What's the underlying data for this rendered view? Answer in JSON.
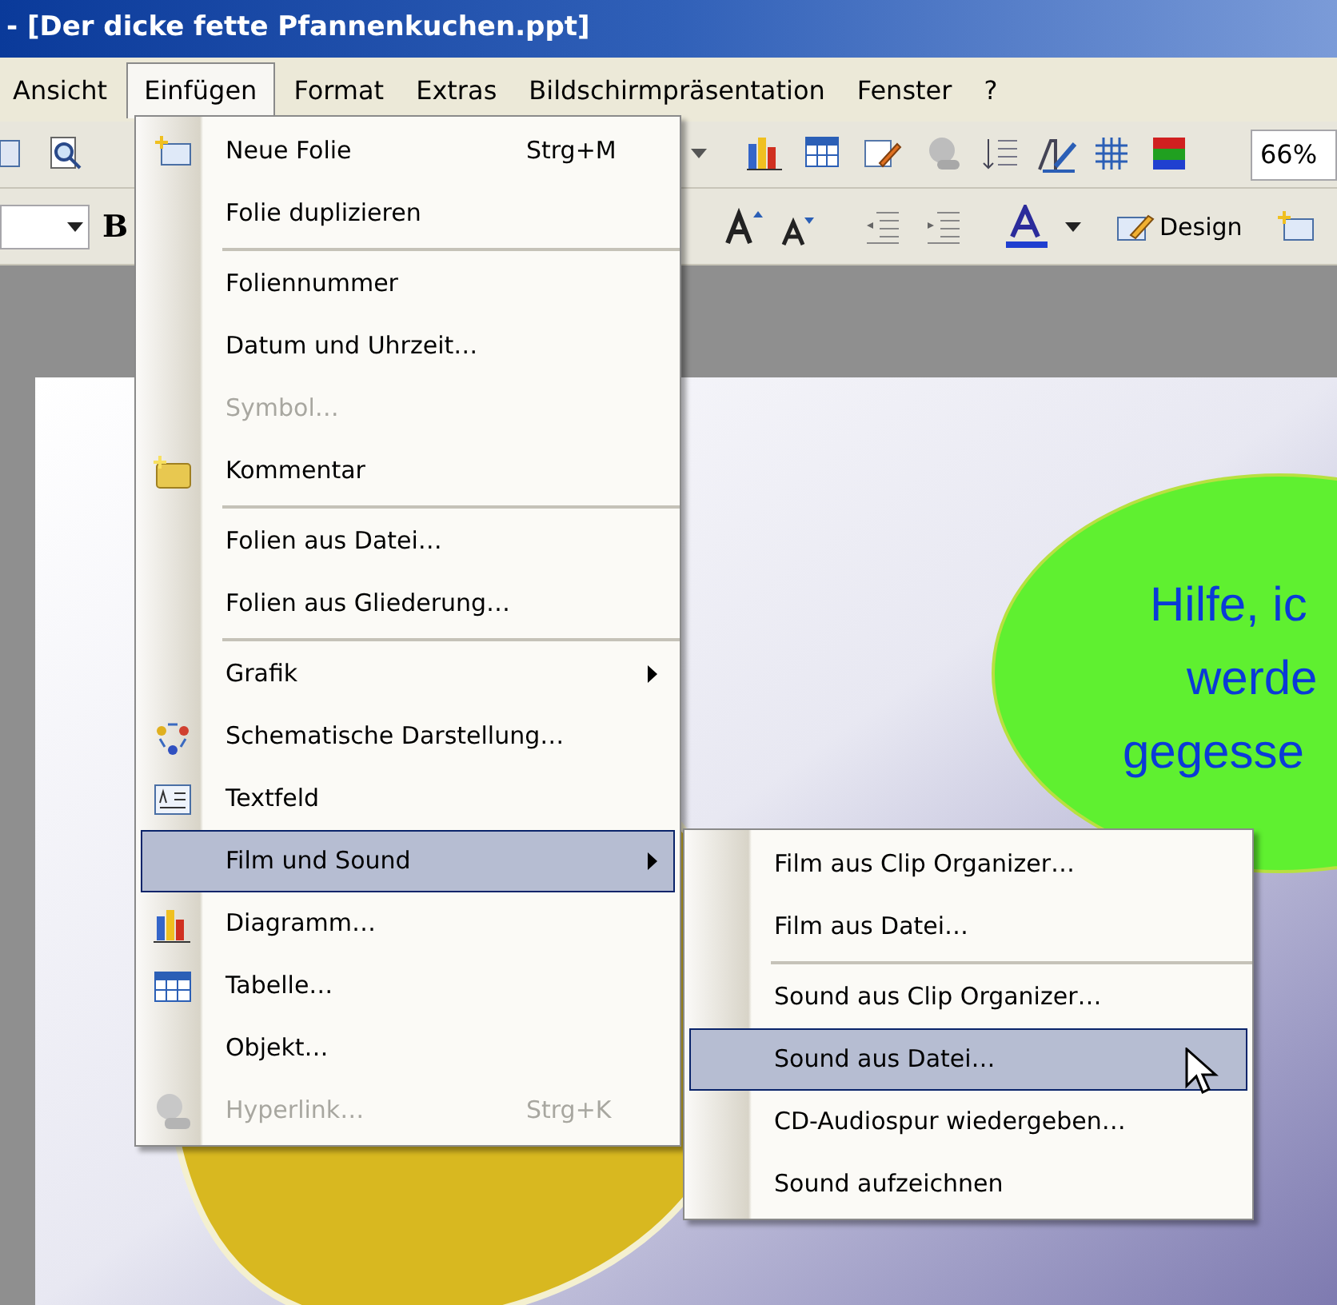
{
  "window": {
    "title": "- [Der dicke fette Pfannenkuchen.ppt]"
  },
  "menu_bar": [
    {
      "label": "Ansicht",
      "selected": false
    },
    {
      "label": "Einfügen",
      "selected": true
    },
    {
      "label": "Format",
      "selected": false
    },
    {
      "label": "Extras",
      "selected": false
    },
    {
      "label": "Bildschirmpräsentation",
      "selected": false
    },
    {
      "label": "Fenster",
      "selected": false
    },
    {
      "label": "?",
      "selected": false
    }
  ],
  "toolbar": {
    "zoom": "66%",
    "bold_button": "B",
    "design_button": "Design"
  },
  "menu": [
    {
      "kind": "item",
      "label": "Neue Folie",
      "shortcut": "Strg+M",
      "disabled": false,
      "submenu": false,
      "selected": false
    },
    {
      "kind": "item",
      "label": "Folie duplizieren",
      "disabled": false,
      "submenu": false,
      "selected": false
    },
    {
      "kind": "separator"
    },
    {
      "kind": "item",
      "label": "Foliennummer",
      "disabled": false,
      "submenu": false,
      "selected": false
    },
    {
      "kind": "item",
      "label": "Datum und Uhrzeit…",
      "disabled": false,
      "submenu": false,
      "selected": false
    },
    {
      "kind": "item",
      "label": "Symbol…",
      "disabled": true,
      "submenu": false,
      "selected": false
    },
    {
      "kind": "item",
      "label": "Kommentar",
      "disabled": false,
      "submenu": false,
      "selected": false
    },
    {
      "kind": "separator"
    },
    {
      "kind": "item",
      "label": "Folien aus Datei…",
      "disabled": false,
      "submenu": false,
      "selected": false
    },
    {
      "kind": "item",
      "label": "Folien aus Gliederung…",
      "disabled": false,
      "submenu": false,
      "selected": false
    },
    {
      "kind": "separator"
    },
    {
      "kind": "item",
      "label": "Grafik",
      "disabled": false,
      "submenu": true,
      "selected": false
    },
    {
      "kind": "item",
      "label": "Schematische Darstellung…",
      "disabled": false,
      "submenu": false,
      "selected": false
    },
    {
      "kind": "item",
      "label": "Textfeld",
      "disabled": false,
      "submenu": false,
      "selected": false
    },
    {
      "kind": "item",
      "label": "Film und Sound",
      "disabled": false,
      "submenu": true,
      "selected": true
    },
    {
      "kind": "item",
      "label": "Diagramm…",
      "disabled": false,
      "submenu": false,
      "selected": false
    },
    {
      "kind": "item",
      "label": "Tabelle…",
      "disabled": false,
      "submenu": false,
      "selected": false
    },
    {
      "kind": "item",
      "label": "Objekt…",
      "disabled": false,
      "submenu": false,
      "selected": false
    },
    {
      "kind": "item",
      "label": "Hyperlink…",
      "shortcut": "Strg+K",
      "disabled": true,
      "submenu": false,
      "selected": false
    }
  ],
  "submenu": [
    {
      "kind": "item",
      "label": "Film aus Clip Organizer…",
      "selected": false
    },
    {
      "kind": "item",
      "label": "Film aus Datei…",
      "selected": false
    },
    {
      "kind": "separator"
    },
    {
      "kind": "item",
      "label": "Sound aus Clip Organizer…",
      "selected": false
    },
    {
      "kind": "item",
      "label": "Sound aus Datei…",
      "selected": true
    },
    {
      "kind": "item",
      "label": "CD-Audiospur wiedergeben…",
      "selected": false
    },
    {
      "kind": "item",
      "label": "Sound aufzeichnen",
      "selected": false
    }
  ],
  "slide": {
    "speech_bubble": [
      "Hilfe, ic",
      "werde",
      "gegesse"
    ]
  }
}
